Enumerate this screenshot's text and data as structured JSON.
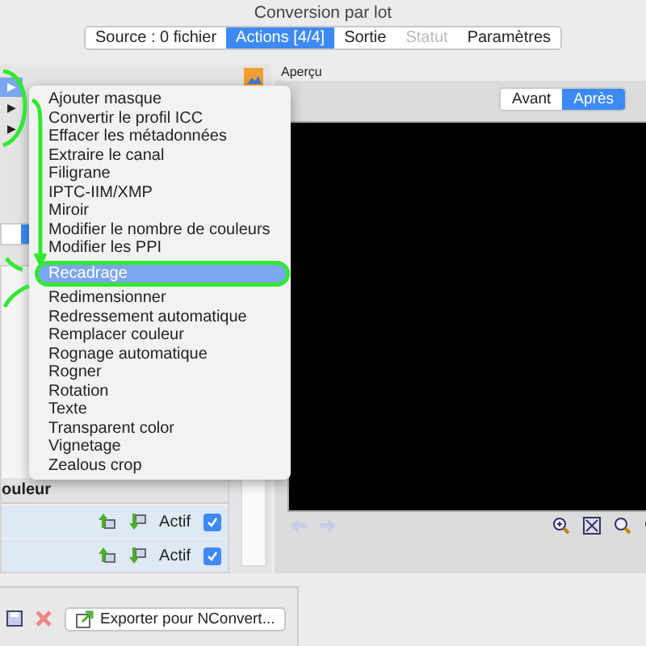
{
  "window": {
    "title": "Conversion par lot"
  },
  "tabs": [
    {
      "label": "Source : 0 fichier",
      "selected": false,
      "disabled": false
    },
    {
      "label": "Actions [4/4]",
      "selected": true,
      "disabled": false
    },
    {
      "label": "Sortie",
      "selected": false,
      "disabled": false
    },
    {
      "label": "Statut",
      "selected": false,
      "disabled": true
    },
    {
      "label": "Paramètres",
      "selected": false,
      "disabled": false
    }
  ],
  "left_panel": {
    "expanders": [
      {
        "selected": true
      },
      {
        "selected": false
      },
      {
        "selected": false
      }
    ],
    "expander_glyph": "▶",
    "column_header": "ouleur",
    "rows": [
      {
        "status": "Actif",
        "checked": true
      },
      {
        "status": "Actif",
        "checked": true
      }
    ]
  },
  "preview": {
    "label": "Aperçu",
    "toggle": [
      {
        "label": "Avant",
        "selected": false
      },
      {
        "label": "Après",
        "selected": true
      }
    ]
  },
  "menu": {
    "items": [
      {
        "label": "Ajouter masque",
        "selected": false
      },
      {
        "label": "Convertir le profil ICC",
        "selected": false
      },
      {
        "label": "Effacer les métadonnées",
        "selected": false
      },
      {
        "label": "Extraire le canal",
        "selected": false
      },
      {
        "label": "Filigrane",
        "selected": false
      },
      {
        "label": "IPTC-IIM/XMP",
        "selected": false
      },
      {
        "label": "Miroir",
        "selected": false
      },
      {
        "label": "Modifier le nombre de couleurs",
        "selected": false
      },
      {
        "label": "Modifier les PPI",
        "selected": false
      },
      {
        "label": "Recadrage",
        "selected": true
      },
      {
        "label": "Redimensionner",
        "selected": false
      },
      {
        "label": "Redressement automatique",
        "selected": false
      },
      {
        "label": "Remplacer couleur",
        "selected": false
      },
      {
        "label": "Rognage automatique",
        "selected": false
      },
      {
        "label": "Rogner",
        "selected": false
      },
      {
        "label": "Rotation",
        "selected": false
      },
      {
        "label": "Texte",
        "selected": false
      },
      {
        "label": "Transparent color",
        "selected": false
      },
      {
        "label": "Vignetage",
        "selected": false
      },
      {
        "label": "Zealous crop",
        "selected": false
      }
    ]
  },
  "bottom_bar": {
    "export_button": "Exporter pour NConvert..."
  }
}
